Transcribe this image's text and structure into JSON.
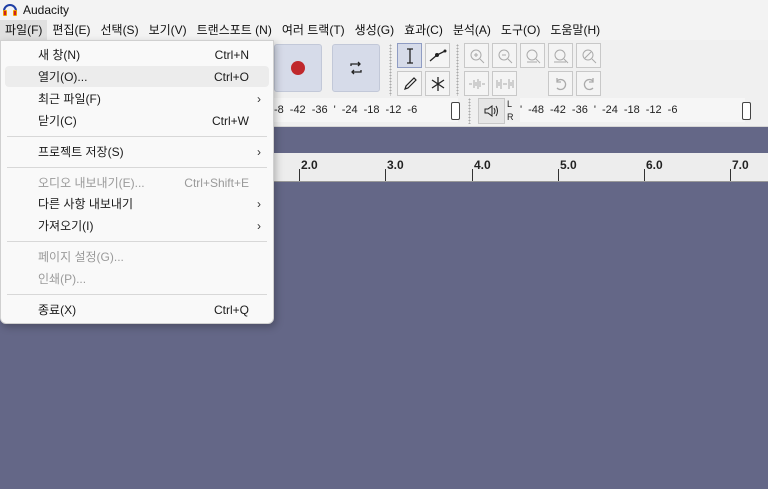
{
  "window": {
    "title": "Audacity"
  },
  "menubar": {
    "items": [
      {
        "label": "파일(F)"
      },
      {
        "label": "편집(E)"
      },
      {
        "label": "선택(S)"
      },
      {
        "label": "보기(V)"
      },
      {
        "label": "트랜스포트 (N)"
      },
      {
        "label": "여러 트랙(T)"
      },
      {
        "label": "생성(G)"
      },
      {
        "label": "효과(C)"
      },
      {
        "label": "분석(A)"
      },
      {
        "label": "도구(O)"
      },
      {
        "label": "도움말(H)"
      }
    ]
  },
  "file_menu": {
    "items": [
      {
        "label": "새 창(N)",
        "shortcut": "Ctrl+N"
      },
      {
        "label": "열기(O)...",
        "shortcut": "Ctrl+O"
      },
      {
        "label": "최근 파일(F)",
        "shortcut": ""
      },
      {
        "label": "닫기(C)",
        "shortcut": "Ctrl+W"
      },
      {
        "label": "프로젝트 저장(S)",
        "shortcut": ""
      },
      {
        "label": "오디오 내보내기(E)...",
        "shortcut": "Ctrl+Shift+E"
      },
      {
        "label": "다른 사항 내보내기",
        "shortcut": ""
      },
      {
        "label": "가져오기(I)",
        "shortcut": ""
      },
      {
        "label": "페이지 설정(G)...",
        "shortcut": ""
      },
      {
        "label": "인쇄(P)...",
        "shortcut": ""
      },
      {
        "label": "종료(X)",
        "shortcut": "Ctrl+Q"
      }
    ]
  },
  "meters": {
    "record_scale": [
      "-8",
      "-42",
      "-36",
      "'",
      "-24",
      "-18",
      "-12",
      "-6"
    ],
    "play_scale": [
      "'",
      "-48",
      "-42",
      "-36",
      "'",
      "-24",
      "-18",
      "-12",
      "-6"
    ],
    "left_label": "L",
    "right_label": "R"
  },
  "ruler": {
    "labels": [
      "2.0",
      "3.0",
      "4.0",
      "5.0",
      "6.0",
      "7.0"
    ]
  },
  "colors": {
    "track_background": "#646787",
    "record_button": "#c0282c",
    "transport_button": "#d6dbe9"
  }
}
